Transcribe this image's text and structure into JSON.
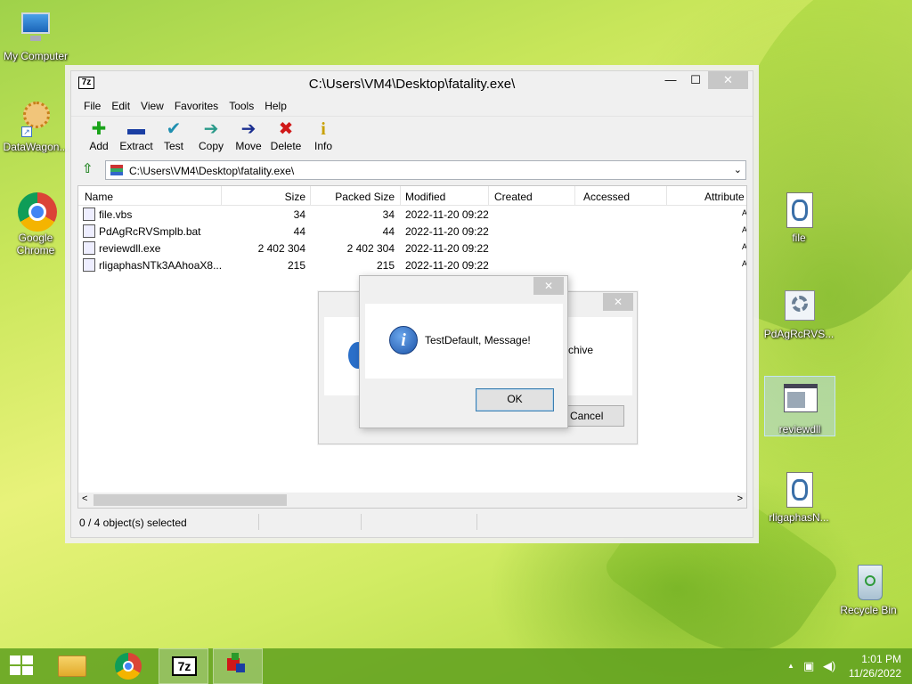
{
  "desktop": {
    "icons_left": [
      {
        "label": "My Computer",
        "icon": "computer-icon"
      },
      {
        "label": "DataWagon...",
        "icon": "datawagon-icon"
      },
      {
        "label": "Google\nChrome",
        "icon": "chrome-icon"
      }
    ],
    "icons_right": [
      {
        "label": "file",
        "icon": "script-icon"
      },
      {
        "label": "PdAgRcRVS...",
        "icon": "batch-icon"
      },
      {
        "label": "reviewdll",
        "icon": "exe-icon",
        "selected": true
      },
      {
        "label": "rligaphasN...",
        "icon": "script-icon"
      },
      {
        "label": "Recycle Bin",
        "icon": "recycle-bin-icon"
      }
    ]
  },
  "window": {
    "title": "C:\\Users\\VM4\\Desktop\\fatality.exe\\",
    "app_icon": "7z",
    "controls": {
      "minimize": "—",
      "maximize": "☐",
      "close": "✕"
    },
    "menu": [
      "File",
      "Edit",
      "View",
      "Favorites",
      "Tools",
      "Help"
    ],
    "toolbar": [
      {
        "label": "Add",
        "icon": "add-icon",
        "glyph": "✚",
        "color": "#1aa31a"
      },
      {
        "label": "Extract",
        "icon": "extract-icon",
        "glyph": "▬",
        "color": "#1a3ea3"
      },
      {
        "label": "Test",
        "icon": "test-icon",
        "glyph": "✔",
        "color": "#1f8fb0"
      },
      {
        "label": "Copy",
        "icon": "copy-icon",
        "glyph": "➔",
        "color": "#2a9a8a"
      },
      {
        "label": "Move",
        "icon": "move-icon",
        "glyph": "➔",
        "color": "#1a2e90"
      },
      {
        "label": "Delete",
        "icon": "delete-icon",
        "glyph": "✖",
        "color": "#d01818"
      },
      {
        "label": "Info",
        "icon": "info-icon",
        "glyph": "i",
        "color": "#c8a000"
      }
    ],
    "address": "C:\\Users\\VM4\\Desktop\\fatality.exe\\",
    "columns": [
      "Name",
      "Size",
      "Packed Size",
      "Modified",
      "Created",
      "Accessed",
      "Attribute"
    ],
    "rows": [
      {
        "name": "file.vbs",
        "size": "34",
        "packed": "34",
        "modified": "2022-11-20 09:22",
        "attr": "A"
      },
      {
        "name": "PdAgRcRVSmplb.bat",
        "size": "44",
        "packed": "44",
        "modified": "2022-11-20 09:22",
        "attr": "A"
      },
      {
        "name": "reviewdll.exe",
        "size": "2 402 304",
        "packed": "2 402 304",
        "modified": "2022-11-20 09:22",
        "attr": "A"
      },
      {
        "name": "rligaphasNTk3AAhoaX8...",
        "size": "215",
        "packed": "215",
        "modified": "2022-11-20 09:22",
        "attr": "A"
      }
    ],
    "status": "0 / 4 object(s) selected"
  },
  "back_dialog": {
    "close": "✕",
    "text": "rchive",
    "cancel_label": "Cancel"
  },
  "message_dialog": {
    "close": "✕",
    "message": "TestDefault, Message!",
    "ok_label": "OK"
  },
  "taskbar": {
    "items": [
      "start-button",
      "file-explorer",
      "google-chrome",
      "7-zip",
      "running-app"
    ],
    "clock_time": "1:01 PM",
    "clock_date": "11/26/2022",
    "tray_up": "▲"
  }
}
